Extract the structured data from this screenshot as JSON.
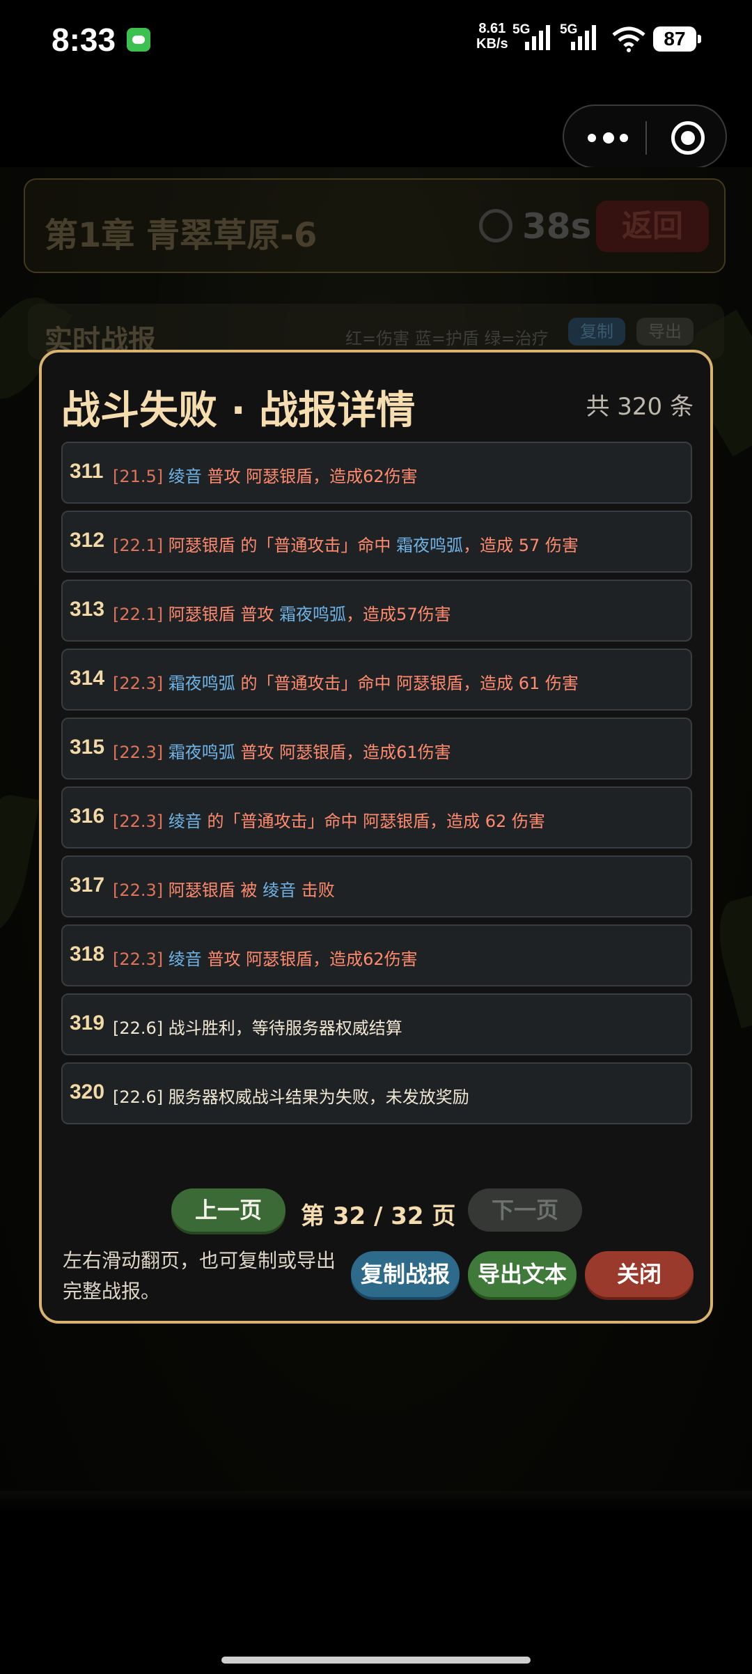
{
  "status_bar": {
    "time": "8:33",
    "net_speed": "8.61",
    "net_unit": "KB/s",
    "sim1": "5G",
    "sim2": "5G",
    "battery": "87"
  },
  "background": {
    "chapter_title": "第1章  青翠草原-6",
    "timer": "38s",
    "back_label": "返回",
    "report_title": "实时战报",
    "legend": "红=伤害  蓝=护盾  绿=治疗",
    "copy_label": "复制",
    "export_label": "导出"
  },
  "modal": {
    "title": "战斗失败 · 战报详情",
    "count": "共 320 条",
    "entries": [
      {
        "num": "311",
        "time": "[21.5]",
        "a": "绫音",
        "b": " 普攻 阿瑟银盾，造成62伤害",
        "c": "",
        "d": ""
      },
      {
        "num": "312",
        "time": "[22.1]",
        "a": "",
        "b": " 阿瑟银盾 的「普通攻击」命中 ",
        "c": "霜夜鸣弧",
        "d": "，造成 57 伤害"
      },
      {
        "num": "313",
        "time": "[22.1]",
        "a": "",
        "b": " 阿瑟银盾 普攻 ",
        "c": "霜夜鸣弧",
        "d": "，造成57伤害"
      },
      {
        "num": "314",
        "time": "[22.3]",
        "a": "霜夜鸣弧",
        "b": " 的「普通攻击」命中 阿瑟银盾，造成 61 伤害",
        "c": "",
        "d": ""
      },
      {
        "num": "315",
        "time": "[22.3]",
        "a": "霜夜鸣弧",
        "b": " 普攻 阿瑟银盾，造成61伤害",
        "c": "",
        "d": ""
      },
      {
        "num": "316",
        "time": "[22.3]",
        "a": "绫音",
        "b": " 的「普通攻击」命中 阿瑟银盾，造成 62 伤害",
        "c": "",
        "d": ""
      },
      {
        "num": "317",
        "time": "[22.3]",
        "a": "",
        "b": " 阿瑟银盾 被 ",
        "c": "绫音",
        "d": " 击败"
      },
      {
        "num": "318",
        "time": "[22.3]",
        "a": "绫音",
        "b": " 普攻 阿瑟银盾，造成62伤害",
        "c": "",
        "d": ""
      },
      {
        "num": "319",
        "time": "[22.6]",
        "text": " 战斗胜利，等待服务器权威结算"
      },
      {
        "num": "320",
        "time": "[22.6]",
        "text": " 服务器权威战斗结果为失败，未发放奖励"
      }
    ],
    "prev_label": "上一页",
    "page_info": "第 32 / 32 页",
    "next_label": "下一页",
    "hint": "左右滑动翻页，也可复制或导出完整战报。",
    "copy_label": "复制战报",
    "export_label": "导出文本",
    "close_label": "关闭"
  },
  "colors": {
    "accent_gold": "#d9b36e",
    "damage_red": "#ff8a6e",
    "name_blue": "#6fb3e6",
    "neutral": "#f0e6d2"
  }
}
